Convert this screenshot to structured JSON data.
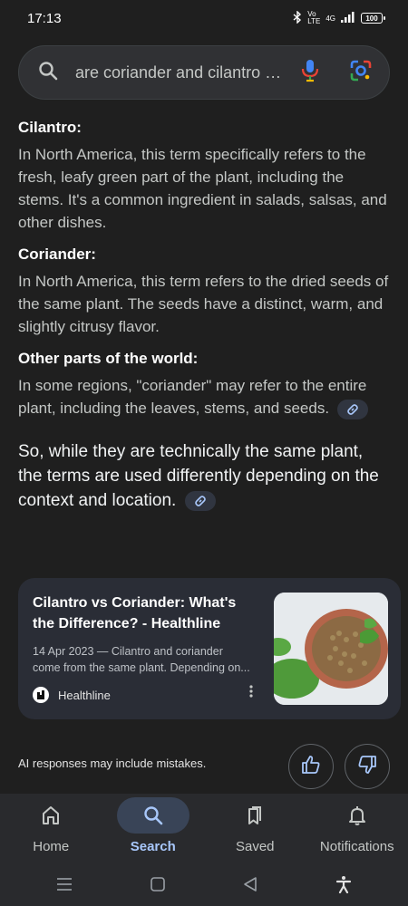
{
  "status_bar": {
    "time": "17:13",
    "network": "4G",
    "battery": "100"
  },
  "search": {
    "query": "are coriander and cilantro the same"
  },
  "answer": {
    "sections": [
      {
        "heading": "Cilantro:",
        "text": "In North America, this term specifically refers to the fresh, leafy green part of the plant, including the stems. It's a common ingredient in salads, salsas, and other dishes."
      },
      {
        "heading": "Coriander:",
        "text": "In North America, this term refers to the dried seeds of the same plant. The seeds have a distinct, warm, and slightly citrusy flavor."
      },
      {
        "heading": "Other parts of the world:",
        "text": "In some regions, \"coriander\" may refer to the entire plant, including the leaves, stems, and seeds."
      }
    ],
    "summary": "So, while they are technically the same plant, the terms are used differently depending on the context and location."
  },
  "source_card": {
    "title": "Cilantro vs Coriander: What's the Difference? - Healthline",
    "date_snippet_line1": "14 Apr 2023 — Cilantro and coriander",
    "date_snippet_line2": "come from the same plant. Depending on...",
    "source_name": "Healthline"
  },
  "footer": {
    "disclaimer": "AI responses may include mistakes."
  },
  "bottom_nav": {
    "items": [
      {
        "label": "Home"
      },
      {
        "label": "Search"
      },
      {
        "label": "Saved"
      },
      {
        "label": "Notifications"
      }
    ]
  },
  "colors": {
    "background": "#1f1f1f",
    "accent": "#a8c7fa",
    "card": "#2a2d36",
    "active_pill": "#394457"
  }
}
